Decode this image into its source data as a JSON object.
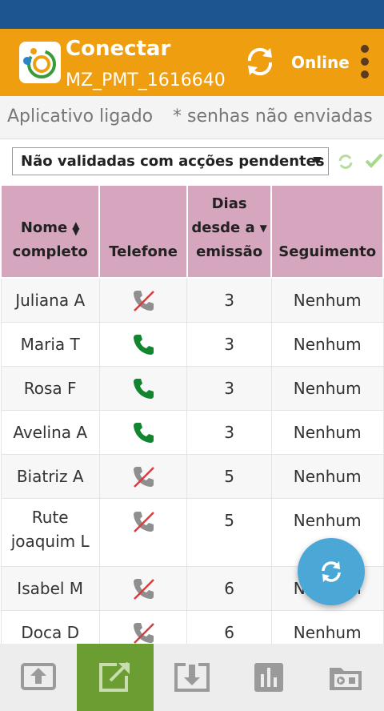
{
  "header": {
    "title": "Conectar",
    "subtitle": "MZ_PMT_1616640",
    "status": "Online"
  },
  "info": {
    "left": "Aplicativo ligado",
    "right": "* senhas não enviadas"
  },
  "filter": {
    "selected": "Não validadas com acções pendentes"
  },
  "table": {
    "headers": {
      "name_line1": "Nome",
      "name_line2": "completo",
      "phone": "Telefone",
      "days_line1": "Dias",
      "days_line2": "desde a",
      "days_line3": "emissão",
      "follow": "Seguimento"
    },
    "rows": [
      {
        "name": "Juliana A",
        "phone": "no-phone",
        "days": "3",
        "follow": "Nenhum"
      },
      {
        "name": "Maria T",
        "phone": "phone",
        "days": "3",
        "follow": "Nenhum"
      },
      {
        "name": "Rosa F",
        "phone": "phone",
        "days": "3",
        "follow": "Nenhum"
      },
      {
        "name": "Avelina A",
        "phone": "phone",
        "days": "3",
        "follow": "Nenhum"
      },
      {
        "name": "Biatriz A",
        "phone": "no-phone",
        "days": "5",
        "follow": "Nenhum"
      },
      {
        "name_line1": "Rute",
        "name_line2": "joaquim L",
        "phone": "no-phone",
        "days": "5",
        "follow": "Nenhum"
      },
      {
        "name": "Isabel M",
        "phone": "no-phone",
        "days": "6",
        "follow": "Nenhum"
      },
      {
        "name": "Doca D",
        "phone": "no-phone",
        "days": "6",
        "follow": "Nenhum"
      }
    ]
  },
  "colors": {
    "statusbar": "#1c5590",
    "appbar": "#ef9e10",
    "header_bg": "#d6a6be",
    "phone_green": "#12852f",
    "fab": "#4aa7d6",
    "active_tab": "#6b9d32"
  },
  "bottom_nav": [
    "upload-icon",
    "open-external-icon",
    "download-icon",
    "bar-chart-icon",
    "media-folder-icon"
  ]
}
